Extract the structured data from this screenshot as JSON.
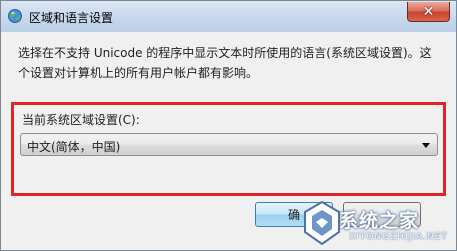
{
  "window": {
    "title": "区域和语言设置",
    "close_label": "✕"
  },
  "dialog": {
    "description": "选择在不支持 Unicode 的程序中显示文本时所使用的语言(系统区域设置)。这个设置对计算机上的所有用户帐户都有影响。",
    "locale_label": "当前系统区域设置(C):",
    "locale_value": "中文(简体，中国)",
    "ok_label": "确"
  },
  "watermark": {
    "text": "系统之家",
    "url": "XITONGZHIJIA.NET"
  },
  "colors": {
    "highlight": "#e0242a"
  },
  "icons": {
    "title": "globe-icon",
    "dropdown": "chevron-down-icon"
  }
}
